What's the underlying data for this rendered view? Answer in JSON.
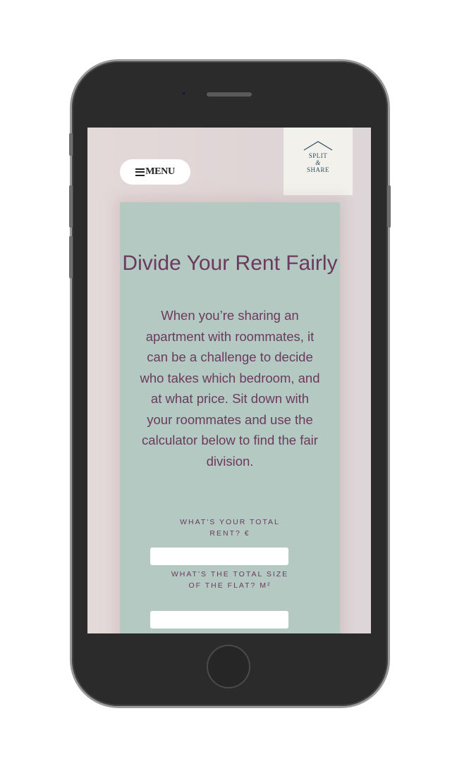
{
  "header": {
    "menu_label": "MENU",
    "logo": {
      "line1": "SPLIT",
      "amp": "&",
      "line2": "SHARE"
    }
  },
  "main": {
    "title": "Divide Your Rent Fairly",
    "description": "When you’re sharing an apartment with roommates, it can be a challenge to decide who takes which bedroom, and at what price. Sit down with your roommates and use the calculator below to find the fair division.",
    "fields": [
      {
        "label": "WHAT'S YOUR TOTAL RENT? €",
        "value": ""
      },
      {
        "label": "WHAT'S THE TOTAL SIZE OF THE FLAT? M²",
        "value": ""
      }
    ]
  },
  "colors": {
    "page_bg": "#e4d9d9",
    "card_bg": "#b4c9c1",
    "accent_text": "#6b3a5e",
    "logo_bg": "#f2f1ec",
    "logo_text": "#2f4f5f"
  },
  "icons": {
    "menu": "hamburger-icon",
    "logo": "house-roof-icon",
    "camera": "camera-icon",
    "home": "home-button-icon"
  }
}
